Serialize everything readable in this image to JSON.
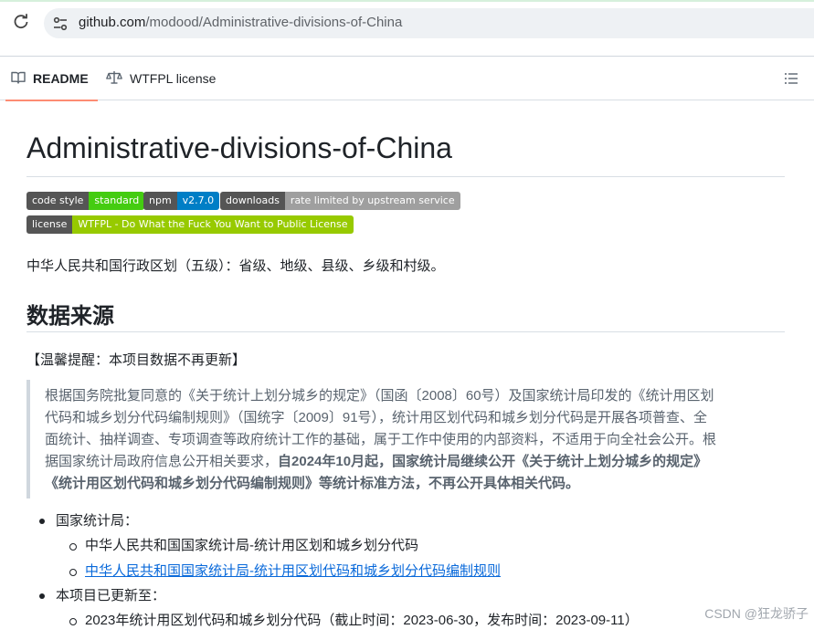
{
  "browser": {
    "url_host": "github.com",
    "url_path": "/modood/Administrative-divisions-of-China"
  },
  "tabs": [
    {
      "label": "README",
      "icon": "book-icon",
      "active": true
    },
    {
      "label": "WTFPL license",
      "icon": "scale-icon",
      "active": false
    }
  ],
  "readme": {
    "title": "Administrative-divisions-of-China",
    "badges": [
      {
        "left": "code style",
        "right": "standard",
        "color": "#44cc11"
      },
      {
        "left": "npm",
        "right": "v2.7.0",
        "color": "#007ec6"
      },
      {
        "left": "downloads",
        "right": "rate limited by upstream service",
        "color": "#9f9f9f"
      },
      {
        "left": "license",
        "right": "WTFPL - Do What the Fuck You Want to Public License",
        "color": "#97ca00"
      }
    ],
    "intro": "中华人民共和国行政区划（五级）：省级、地级、县级、乡级和村级。",
    "section_heading": "数据来源",
    "notice": "【温馨提醒：本项目数据不再更新】",
    "quote": {
      "line1": "根据国务院批复同意的《关于统计上划分城乡的规定》（国函〔2008〕60号）及国家统计局印发的《统计用区划",
      "line2": "代码和城乡划分代码编制规则》（国统字〔2009〕91号），统计用区划代码和城乡划分代码是开展各项普查、全",
      "line3": "面统计、抽样调查、专项调查等政府统计工作的基础，属于工作中使用的内部资料，不适用于向全社会公开。根",
      "line4_plain": "据国家统计局政府信息公开相关要求，",
      "line4_bold": "自2024年10月起，国家统计局继续公开《关于统计上划分城乡的规定》",
      "line5_bold": "《统计用区划代码和城乡划分代码编制规则》等统计标准方法，不再公开具体相关代码。"
    },
    "list": {
      "item1": "国家统计局：",
      "item1_sub1": "中华人民共和国国家统计局-统计用区划和城乡划分代码",
      "item1_sub2": "中华人民共和国国家统计局-统计用区划代码和城乡划分代码编制规则",
      "item2": "本项目已更新至：",
      "item2_sub1": "2023年统计用区划代码和城乡划分代码（截止时间：2023-06-30，发布时间：2023-09-11）"
    }
  },
  "watermark": "CSDN @狂龙骄子"
}
